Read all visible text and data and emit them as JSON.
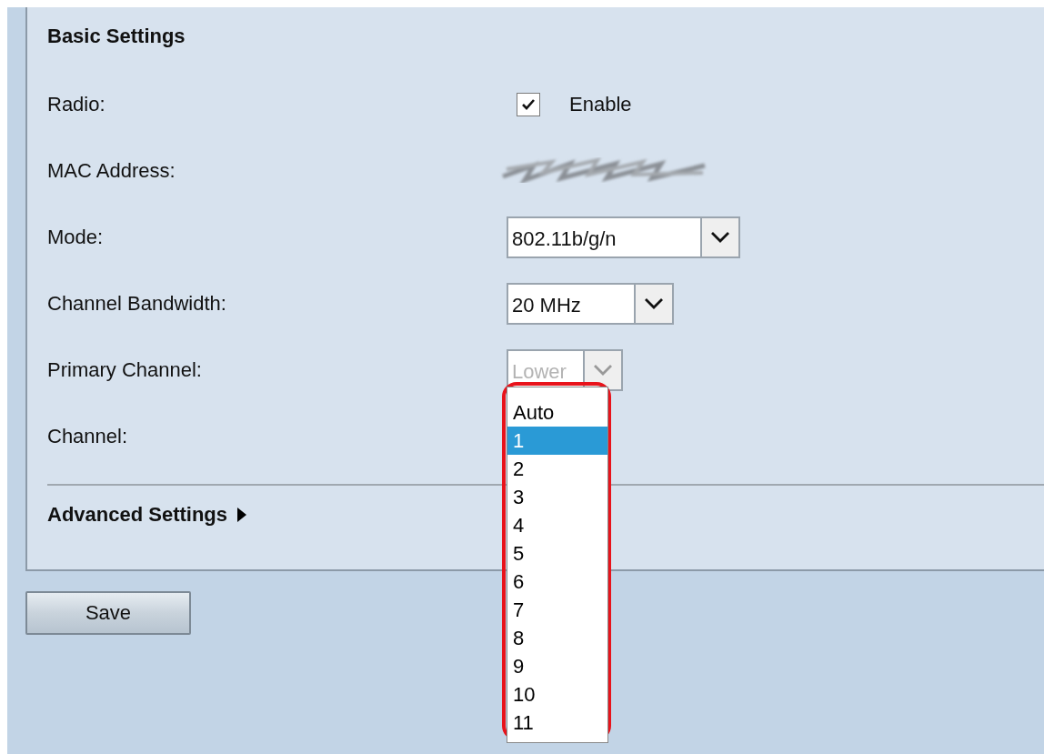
{
  "section": {
    "title": "Basic Settings"
  },
  "fields": [
    {
      "kind": "checkbox",
      "label": "Radio:",
      "checked": true,
      "text": "Enable"
    },
    {
      "kind": "redacted",
      "label": "MAC Address:"
    },
    {
      "kind": "select",
      "label": "Mode:",
      "value": "802.11b/g/n",
      "disabled": false
    },
    {
      "kind": "select",
      "label": "Channel Bandwidth:",
      "value": "20 MHz",
      "disabled": false
    },
    {
      "kind": "select",
      "label": "Primary Channel:",
      "value": "Lower",
      "disabled": true
    },
    {
      "kind": "open_select",
      "label": "Channel:",
      "highlighted": true,
      "options": [
        {
          "label": "Auto",
          "selected": false
        },
        {
          "label": "1",
          "selected": true
        },
        {
          "label": "2",
          "selected": false
        },
        {
          "label": "3",
          "selected": false
        },
        {
          "label": "4",
          "selected": false
        },
        {
          "label": "5",
          "selected": false
        },
        {
          "label": "6",
          "selected": false
        },
        {
          "label": "7",
          "selected": false
        },
        {
          "label": "8",
          "selected": false
        },
        {
          "label": "9",
          "selected": false
        },
        {
          "label": "10",
          "selected": false
        },
        {
          "label": "11",
          "selected": false
        }
      ]
    }
  ],
  "advanced": {
    "title": "Advanced Settings",
    "expanded": false
  },
  "buttons": [
    {
      "label": "Save"
    }
  ]
}
